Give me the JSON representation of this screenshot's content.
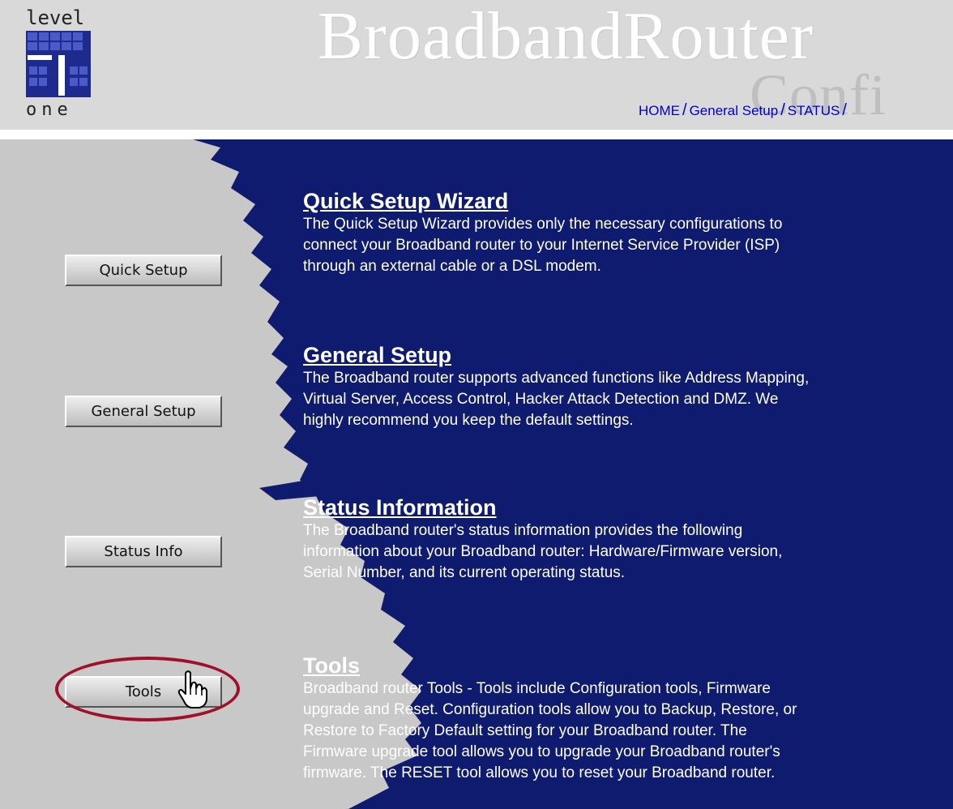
{
  "header": {
    "logo_top": "level",
    "logo_bottom": "one",
    "title": "BroadbandRouter",
    "title_overflow": "Confi",
    "nav": [
      "HOME",
      "General Setup",
      "STATUS"
    ],
    "nav_separator": "/"
  },
  "sidebar": {
    "quick_setup": "Quick Setup",
    "general_setup": "General Setup",
    "status_info": "Status Info",
    "tools": "Tools"
  },
  "sections": {
    "quick": {
      "title": "Quick Setup Wizard",
      "lines": [
        "The Quick Setup Wizard provides only the necessary configurations to",
        "connect your Broadband router to your Internet Service Provider (ISP)",
        "through an external cable or a DSL modem."
      ]
    },
    "general": {
      "title": "General Setup",
      "lines": [
        "The Broadband router supports advanced functions like Address Mapping,",
        "Virtual Server, Access Control, Hacker Attack Detection and DMZ. We",
        "highly recommend you keep the default settings."
      ]
    },
    "status": {
      "title": "Status Information",
      "lines": [
        "The Broadband router's status information provides the following",
        "information about your Broadband router: Hardware/Firmware version,",
        "Serial Number, and its current operating status."
      ]
    },
    "tools": {
      "title": "Tools",
      "lines": [
        "Broadband router Tools - Tools include Configuration tools, Firmware",
        "upgrade and Reset. Configuration tools allow you to Backup, Restore, or",
        "Restore to Factory Default setting for your Broadband router. The",
        "Firmware upgrade tool allows you to upgrade your Broadband router's",
        "firmware. The RESET tool allows you to reset your Broadband router."
      ]
    }
  },
  "colors": {
    "blue": "#0e1b6e",
    "panel_gray": "#c8c8c8",
    "header_gray": "#d9d9d9",
    "highlight_ring": "#a0102a",
    "nav_link": "#0000cc"
  },
  "icons": {
    "logo": "level-one-logo",
    "cursor": "hand-pointer-cursor"
  }
}
